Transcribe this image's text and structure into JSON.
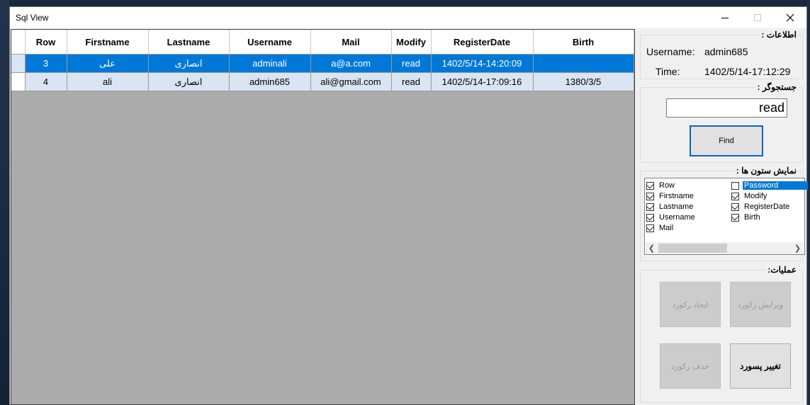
{
  "window": {
    "title": "Sql View"
  },
  "grid": {
    "columns": [
      "Row",
      "Firstname",
      "Lastname",
      "Username",
      "Mail",
      "Modify",
      "RegisterDate",
      "Birth"
    ],
    "rows": [
      [
        "3",
        "علی",
        "انصاری",
        "adminali",
        "a@a.com",
        "read",
        "1402/5/14-14:20:09",
        ""
      ],
      [
        "4",
        "ali",
        "انصاری",
        "admin685",
        "ali@gmail.com",
        "read",
        "1402/5/14-17:09:16",
        "1380/3/5"
      ]
    ]
  },
  "info": {
    "title": "اطلاعات :",
    "username_label": "Username:",
    "username_value": "admin685",
    "time_label": "Time:",
    "time_value": "1402/5/14-17:12:29"
  },
  "search": {
    "title": "جستجوگر :",
    "value": "read",
    "find_label": "Find"
  },
  "columns_group": {
    "title": "نمایش ستون ها :",
    "items": [
      {
        "label": "Row",
        "checked": true
      },
      {
        "label": "Firstname",
        "checked": true
      },
      {
        "label": "Lastname",
        "checked": true
      },
      {
        "label": "Username",
        "checked": true
      },
      {
        "label": "Mail",
        "checked": true
      },
      {
        "label": "Password",
        "checked": false
      },
      {
        "label": "Modify",
        "checked": true
      },
      {
        "label": "RegisterDate",
        "checked": true
      },
      {
        "label": "Birth",
        "checked": true
      }
    ]
  },
  "operations": {
    "title": "عملیات:",
    "edit_label": "ویرایش رکورد",
    "create_label": "ایجاد رکورد",
    "change_password_label": "تغییر پسورد",
    "delete_label": "حذف رکورد"
  },
  "colors": {
    "selection": "#0078d7",
    "alt_row": "#d9e5f3",
    "grid_background": "#ababab",
    "focus_border": "#0a64c8"
  }
}
